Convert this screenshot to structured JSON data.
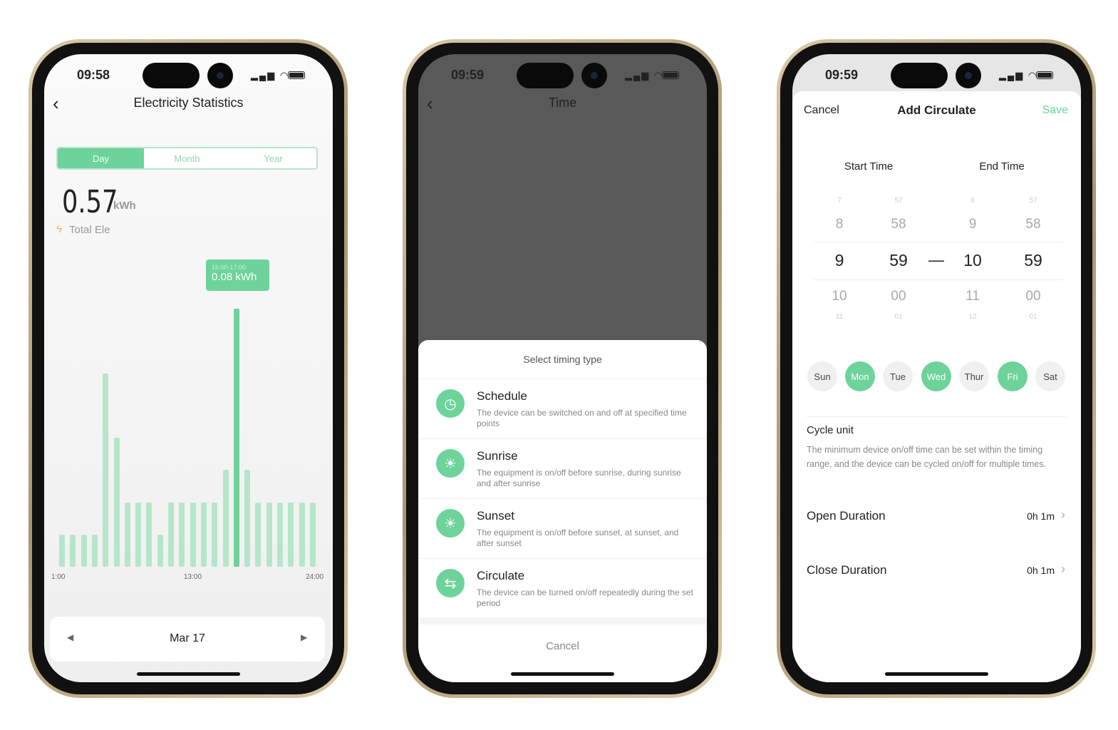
{
  "colors": {
    "accent": "#6dd39a",
    "bar": "#b5e6c9"
  },
  "phone1": {
    "time": "09:58",
    "title": "Electricity Statistics",
    "tabs": [
      "Day",
      "Month",
      "Year"
    ],
    "active_tab": "Day",
    "total_value": "0.57",
    "total_unit": "kWh",
    "total_label": "Total Ele",
    "tooltip": {
      "range": "16:00-17:00",
      "value": "0.08 kWh"
    },
    "date": "Mar 17",
    "chart_data": {
      "type": "bar",
      "categories": [
        "1:00",
        "2:00",
        "3:00",
        "4:00",
        "5:00",
        "6:00",
        "7:00",
        "8:00",
        "9:00",
        "10:00",
        "11:00",
        "12:00",
        "13:00",
        "14:00",
        "15:00",
        "16:00",
        "17:00",
        "18:00",
        "19:00",
        "20:00",
        "21:00",
        "22:00",
        "23:00",
        "24:00"
      ],
      "values": [
        0.01,
        0.01,
        0.01,
        0.01,
        0.06,
        0.04,
        0.02,
        0.02,
        0.02,
        0.01,
        0.02,
        0.02,
        0.02,
        0.02,
        0.02,
        0.03,
        0.08,
        0.03,
        0.02,
        0.02,
        0.02,
        0.02,
        0.02,
        0.02
      ],
      "unit": "kWh",
      "selected_index": 16,
      "xticks": [
        "1:00",
        "13:00",
        "24:00"
      ],
      "ylim": [
        0,
        0.08
      ],
      "grid": false
    }
  },
  "phone2": {
    "time": "09:59",
    "title": "Time",
    "sheet_title": "Select timing type",
    "items": [
      {
        "icon": "clock-icon",
        "glyph": "◷",
        "title": "Schedule",
        "desc": "The device can be switched on and off at specified time points"
      },
      {
        "icon": "sunrise-icon",
        "glyph": "☀",
        "title": "Sunrise",
        "desc": "The equipment is on/off before sunrise, during sunrise and after sunrise"
      },
      {
        "icon": "sunset-icon",
        "glyph": "☀",
        "title": "Sunset",
        "desc": "The equipment is on/off before sunset, at sunset, and after sunset"
      },
      {
        "icon": "cycle-icon",
        "glyph": "⇆",
        "title": "Circulate",
        "desc": "The device can be turned on/off repeatedly during the set period"
      }
    ],
    "cancel": "Cancel"
  },
  "phone3": {
    "time": "09:59",
    "cancel": "Cancel",
    "title": "Add Circulate",
    "save": "Save",
    "start_label": "Start Time",
    "end_label": "End Time",
    "picker": {
      "start_hour": [
        "7",
        "8",
        "9",
        "10",
        "11"
      ],
      "start_min": [
        "57",
        "58",
        "59",
        "00",
        "01"
      ],
      "end_hour": [
        "8",
        "9",
        "10",
        "11",
        "12"
      ],
      "end_min": [
        "57",
        "58",
        "59",
        "00",
        "01"
      ],
      "separator": "—"
    },
    "days": [
      {
        "label": "Sun",
        "on": false
      },
      {
        "label": "Mon",
        "on": true
      },
      {
        "label": "Tue",
        "on": false
      },
      {
        "label": "Wed",
        "on": true
      },
      {
        "label": "Thur",
        "on": false
      },
      {
        "label": "Fri",
        "on": true
      },
      {
        "label": "Sat",
        "on": false
      }
    ],
    "cycle_title": "Cycle unit",
    "cycle_desc": "The minimum device on/off time can be set within the timing range, and the device can be cycled on/off for multiple times.",
    "open_label": "Open Duration",
    "open_value": "0h 1m",
    "close_label": "Close Duration",
    "close_value": "0h 1m"
  }
}
